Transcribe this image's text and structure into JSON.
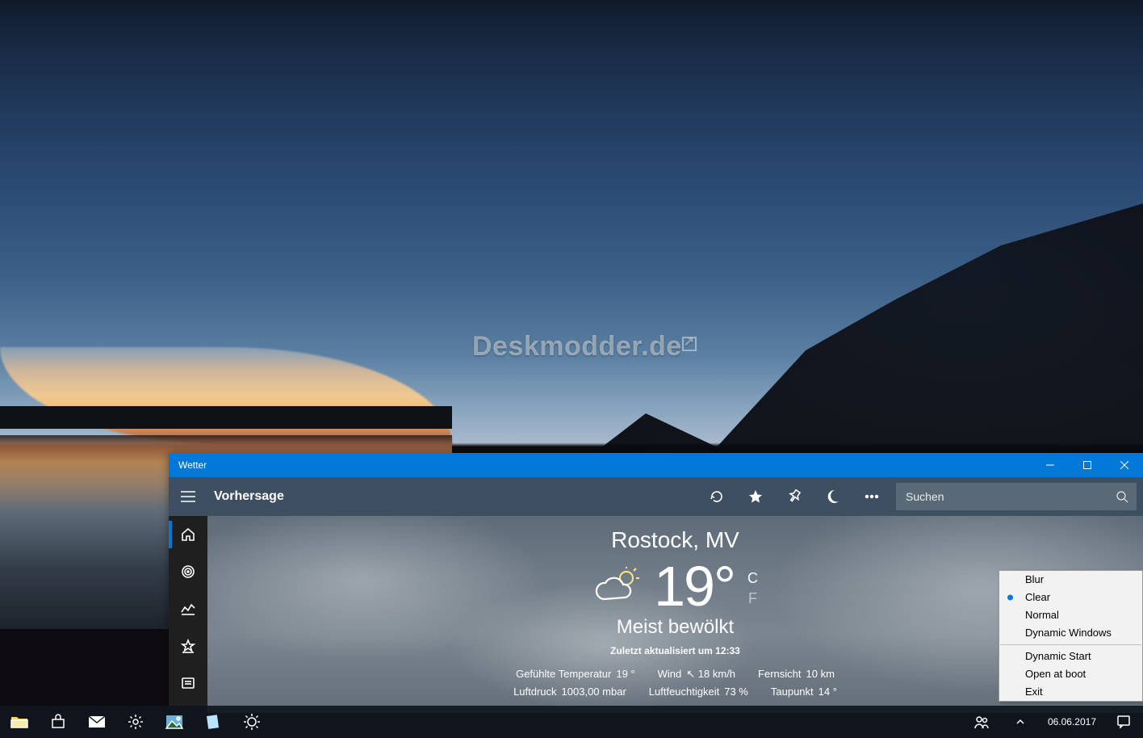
{
  "watermark": "Deskmodder.de",
  "window": {
    "title": "Wetter",
    "commandbar": {
      "heading": "Vorhersage"
    },
    "search": {
      "placeholder": "Suchen"
    }
  },
  "weather": {
    "location": "Rostock, MV",
    "temp": "19",
    "deg": "°",
    "unit_c": "C",
    "unit_f": "F",
    "condition": "Meist bewölkt",
    "updated": "Zuletzt aktualisiert um 12:33",
    "metrics1": [
      {
        "label": "Gefühlte Temperatur",
        "value": "19 °"
      },
      {
        "label": "Wind",
        "value": "18 km/h",
        "prefix": "↖"
      },
      {
        "label": "Fernsicht",
        "value": "10 km"
      }
    ],
    "metrics2": [
      {
        "label": "Luftdruck",
        "value": "1003,00 mbar"
      },
      {
        "label": "Luftfeuchtigkeit",
        "value": "73 %"
      },
      {
        "label": "Taupunkt",
        "value": "14 °"
      }
    ]
  },
  "context_menu": {
    "items": [
      "Blur",
      "Clear",
      "Normal",
      "Dynamic Windows"
    ],
    "selected_index": 1,
    "items2": [
      "Dynamic Start",
      "Open at boot",
      "Exit"
    ]
  },
  "tray": {
    "time": "",
    "date": "06.06.2017"
  }
}
